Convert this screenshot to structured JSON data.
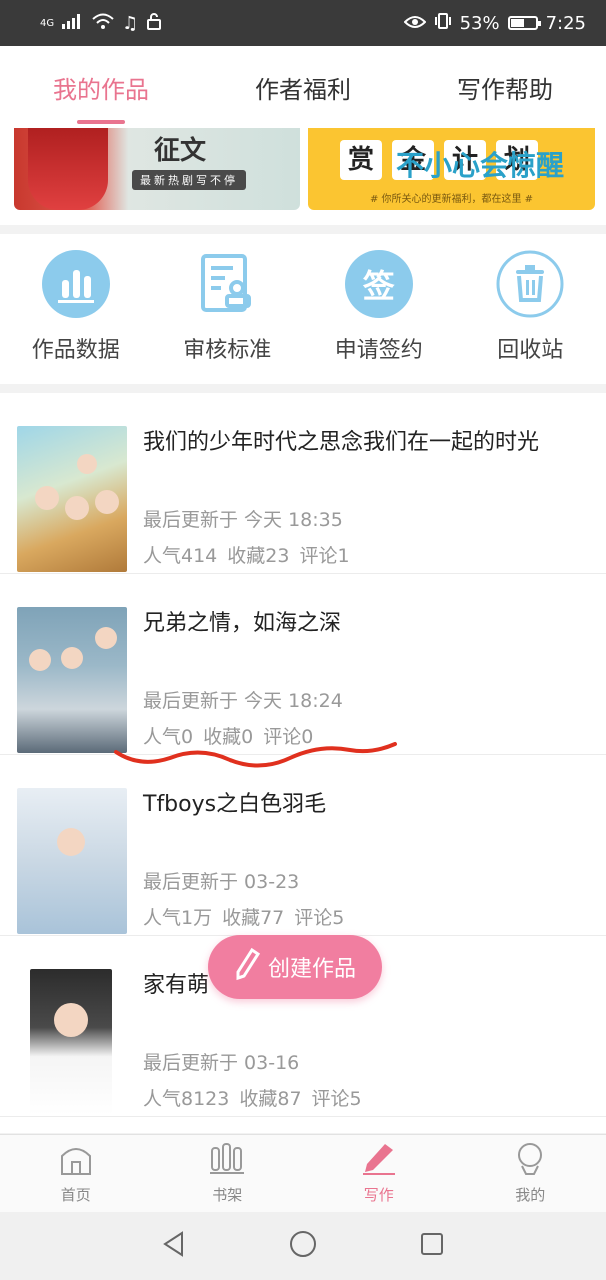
{
  "status_bar": {
    "network": "4G",
    "battery_pct": "53%",
    "battery_level": 0.53,
    "time": "7:25"
  },
  "tabs": [
    {
      "label": "我的作品",
      "active": true
    },
    {
      "label": "作者福利",
      "active": false
    },
    {
      "label": "写作帮助",
      "active": false
    }
  ],
  "banners": {
    "left": {
      "title": "征文",
      "subtitle": "最新热剧写不停"
    },
    "right": {
      "chars": [
        "赏",
        "金",
        "计",
        "划"
      ],
      "overlay": "不小心会惊醒",
      "caption": "# 你所关心的更新福利，都在这里 #"
    }
  },
  "quick_actions": [
    {
      "label": "作品数据",
      "icon": "bar-chart-icon"
    },
    {
      "label": "审核标准",
      "icon": "document-stamp-icon"
    },
    {
      "label": "申请签约",
      "icon": "sign-icon",
      "glyph": "签"
    },
    {
      "label": "回收站",
      "icon": "trash-icon"
    }
  ],
  "works": [
    {
      "title": "我们的少年时代之思念我们在一起的时光",
      "updated": "最后更新于 今天 18:35",
      "popularity": "人气414",
      "favorites": "收藏23",
      "comments": "评论1"
    },
    {
      "title": "兄弟之情，如海之深",
      "updated": "最后更新于 今天 18:24",
      "popularity": "人气0",
      "favorites": "收藏0",
      "comments": "评论0"
    },
    {
      "title": "Tfboys之白色羽毛",
      "updated": "最后更新于 03-23",
      "popularity": "人气1万",
      "favorites": "收藏77",
      "comments": "评论5"
    },
    {
      "title": "家有萌",
      "updated": "最后更新于 03-16",
      "popularity": "人气8123",
      "favorites": "收藏87",
      "comments": "评论5"
    }
  ],
  "fab": {
    "label": "创建作品"
  },
  "bottom_nav": [
    {
      "label": "首页",
      "icon": "home-icon",
      "active": false
    },
    {
      "label": "书架",
      "icon": "bookshelf-icon",
      "active": false
    },
    {
      "label": "写作",
      "icon": "pen-icon",
      "active": true
    },
    {
      "label": "我的",
      "icon": "profile-icon",
      "active": false
    }
  ],
  "colors": {
    "accent": "#e9748f",
    "fab": "#f17ea0",
    "icon_blue": "#8ccbec",
    "annotation": "#e0301e"
  }
}
